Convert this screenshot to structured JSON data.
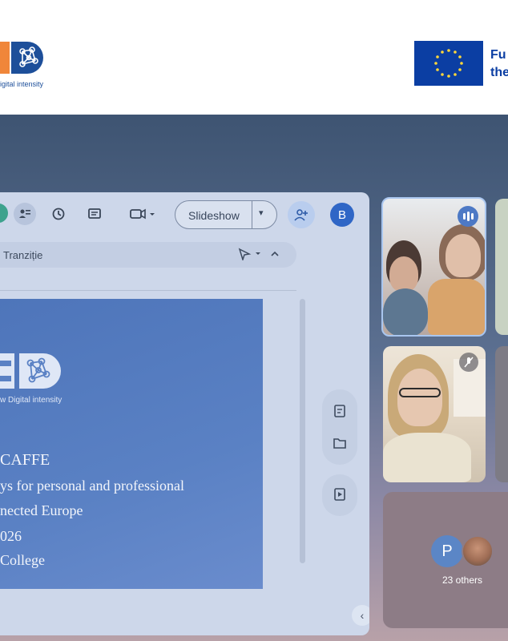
{
  "banner": {
    "logo_tagline": "igital intensity",
    "eu_text_line1": "Fu",
    "eu_text_line2": "the"
  },
  "toolbar": {
    "slideshow_label": "Slideshow",
    "user_avatar_letter": "B",
    "icons": [
      "people-icon",
      "history-icon",
      "comment-icon",
      "camera-icon",
      "add-person-icon"
    ]
  },
  "menubar": {
    "transition_label": "Tranziție"
  },
  "slide": {
    "logo_tagline": "w Digital intensity",
    "line1": "CAFFE",
    "line2": "ys for personal and professional",
    "line3": "nected Europe",
    "line4": "026",
    "line5": "College"
  },
  "participants": {
    "others_avatar_letter": "P",
    "others_label": "23 others"
  },
  "colors": {
    "accent_blue": "#2f66c6",
    "slide_blue": "#5a81c4",
    "eu_blue": "#0b3ea3",
    "logo_orange": "#f0863a"
  }
}
